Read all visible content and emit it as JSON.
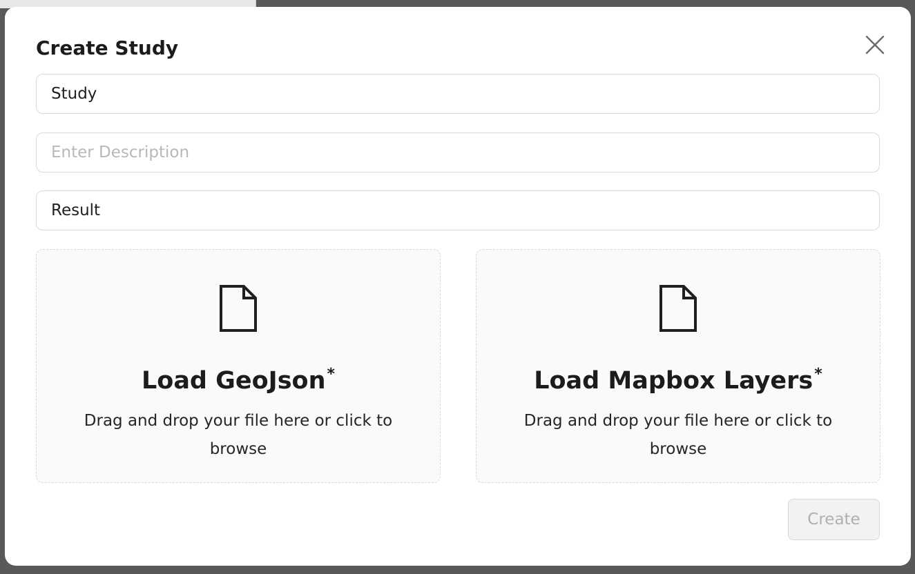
{
  "modal": {
    "title": "Create Study",
    "close_icon": "close-icon"
  },
  "form": {
    "name": {
      "value": "Study",
      "placeholder": ""
    },
    "description": {
      "value": "",
      "placeholder": "Enter Description"
    },
    "result": {
      "value": "Result",
      "placeholder": ""
    }
  },
  "upload_zones": [
    {
      "title": "Load GeoJson",
      "required_marker": "*",
      "description": "Drag and drop your file here or click to browse",
      "icon": "file-icon"
    },
    {
      "title": "Load Mapbox Layers",
      "required_marker": "*",
      "description": "Drag and drop your file here or click to browse",
      "icon": "file-icon"
    }
  ],
  "actions": {
    "create_label": "Create",
    "create_disabled": true
  },
  "colors": {
    "backdrop": "#595959",
    "modal_bg": "#ffffff",
    "border": "#d9d9d9",
    "dropzone_bg": "#fafafa",
    "text": "#1c1c1c",
    "disabled_text": "#b0b0b0"
  }
}
